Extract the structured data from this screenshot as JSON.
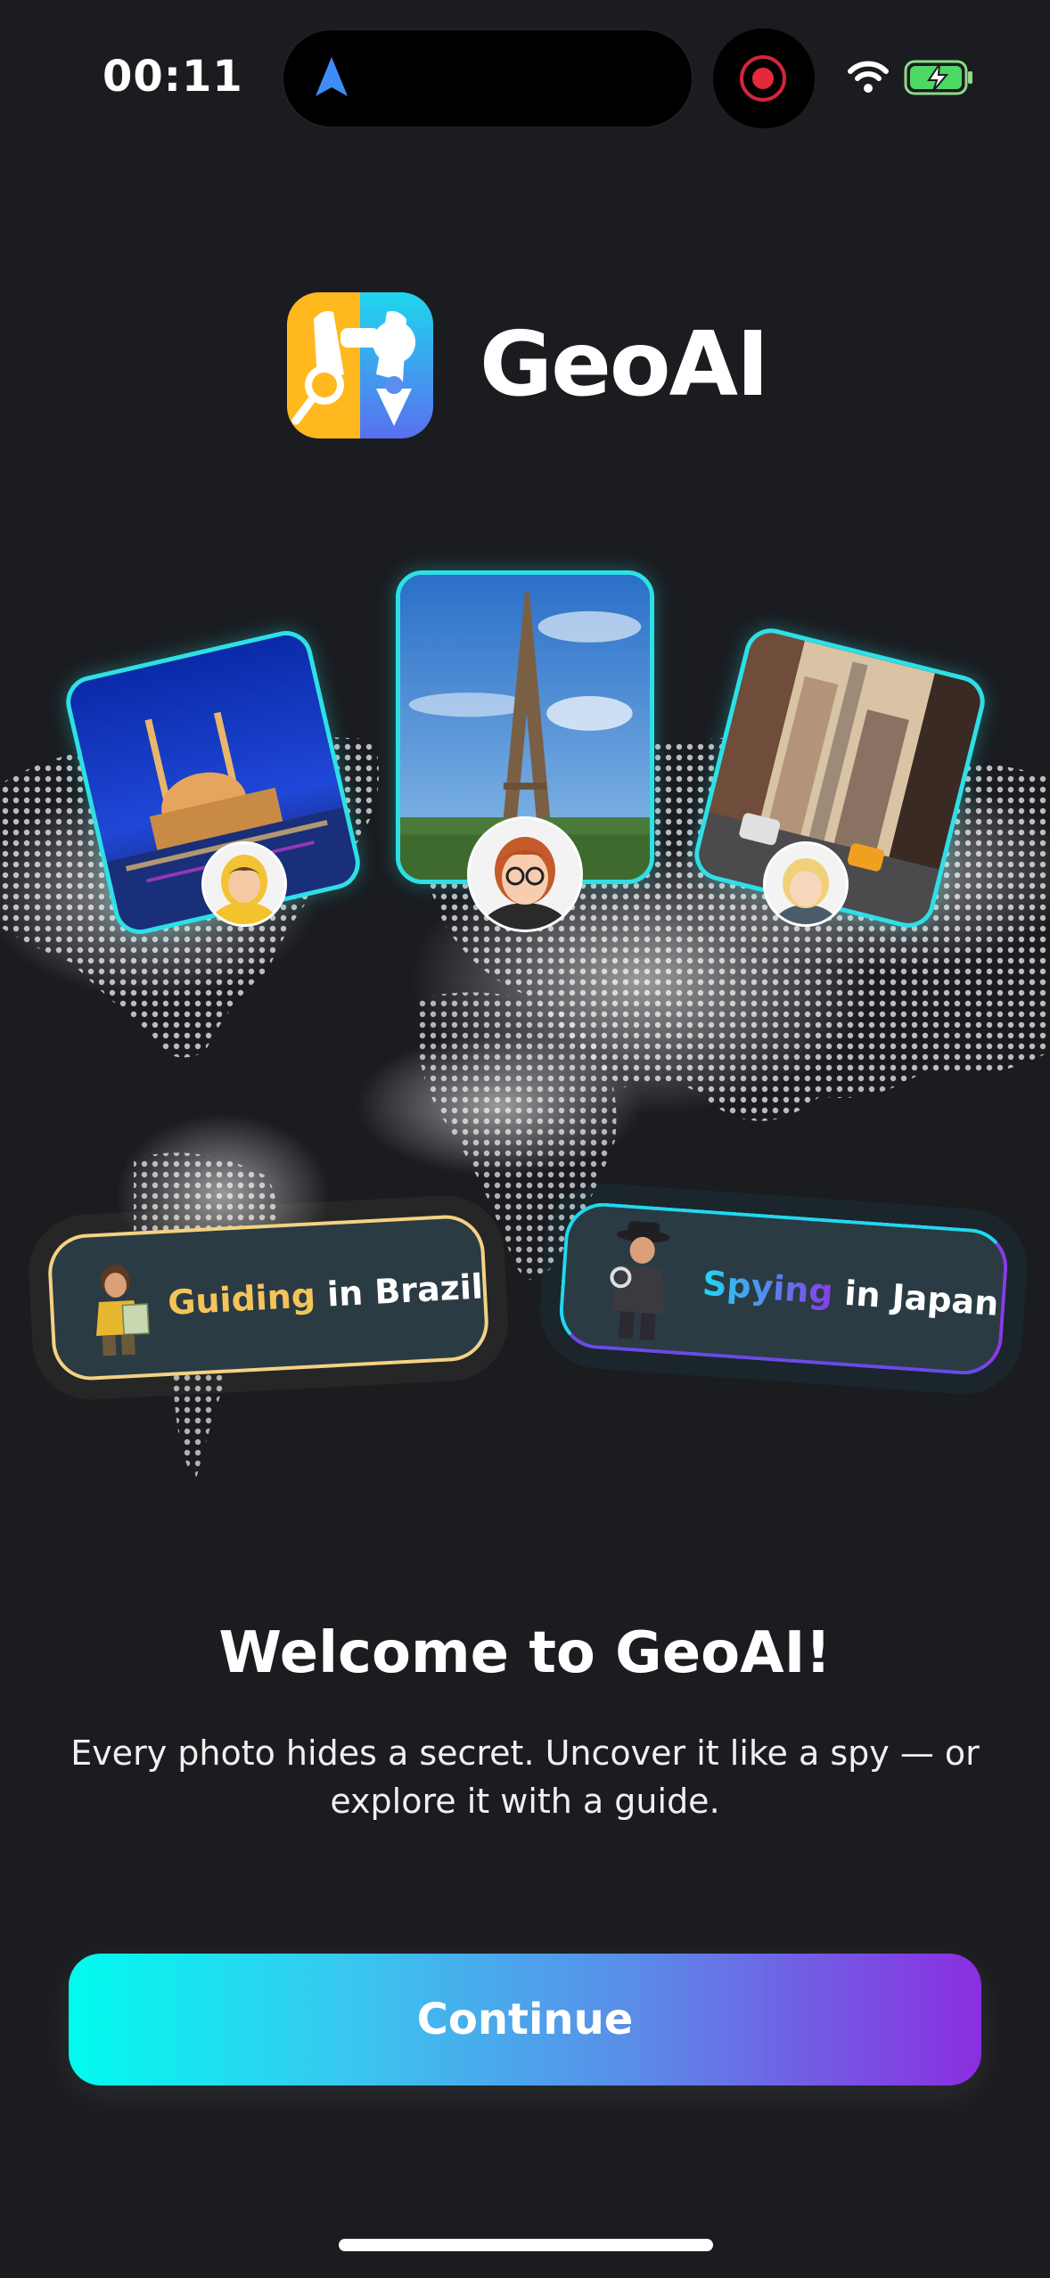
{
  "status_bar": {
    "time": "00:11"
  },
  "app": {
    "name": "GeoAI"
  },
  "modes": [
    {
      "keyword": "Guiding",
      "suffix": " in Brazil",
      "color": "#f4c45a"
    },
    {
      "keyword": "Spying",
      "suffix": " in Japan",
      "color_start": "#22d8f0",
      "color_end": "#8a3ae8"
    }
  ],
  "welcome": {
    "title": "Welcome to GeoAI!",
    "subtitle": "Every photo hides a secret. Uncover it like a spy — or explore it with a guide."
  },
  "continue_button": {
    "label": "Continue"
  },
  "colors": {
    "accent_cyan": "#00fbef",
    "accent_purple": "#8a2ee0",
    "background": "#1a1c20"
  }
}
